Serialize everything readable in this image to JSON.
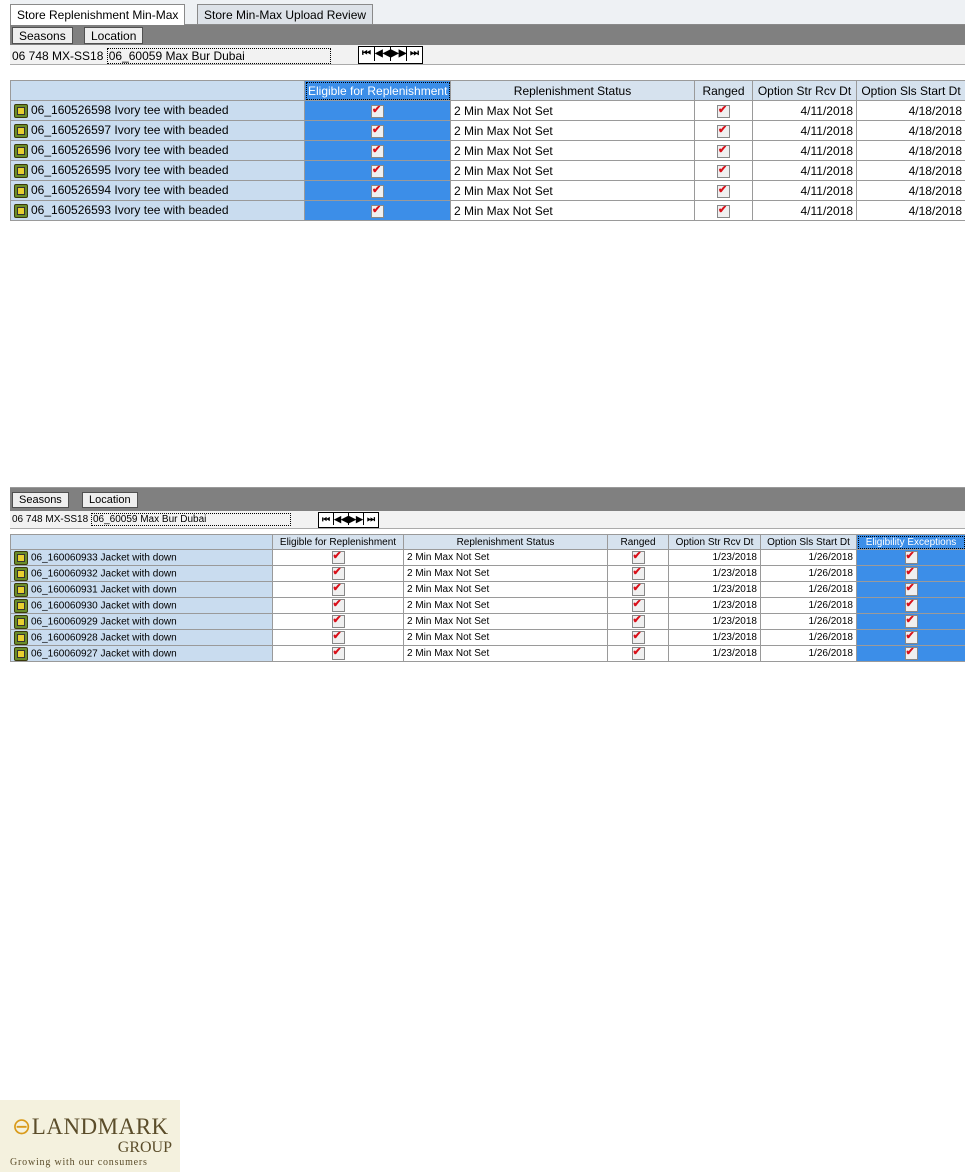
{
  "panel1": {
    "tabs": [
      "Store Replenishment Min-Max",
      "Store Min-Max Upload Review"
    ],
    "buttons": {
      "seasons": "Seasons",
      "location": "Location"
    },
    "location_prefix": "06  748  MX-SS18",
    "location_value": "06_60059 Max Bur Dubai",
    "nav": [
      "⏮",
      "◀◀",
      "▶▶",
      "⏭"
    ],
    "columns": [
      "Eligible for Replenishment",
      "Replenishment Status",
      "Ranged",
      "Option Str Rcv Dt",
      "Option Sls Start Dt"
    ],
    "rows": [
      {
        "label": "06_160526598 Ivory tee with beaded",
        "status": "2 Min Max Not Set",
        "rcv": "4/11/2018",
        "sls": "4/18/2018"
      },
      {
        "label": "06_160526597 Ivory tee with beaded",
        "status": "2 Min Max Not Set",
        "rcv": "4/11/2018",
        "sls": "4/18/2018"
      },
      {
        "label": "06_160526596 Ivory tee with beaded",
        "status": "2 Min Max Not Set",
        "rcv": "4/11/2018",
        "sls": "4/18/2018"
      },
      {
        "label": "06_160526595 Ivory tee with beaded",
        "status": "2 Min Max Not Set",
        "rcv": "4/11/2018",
        "sls": "4/18/2018"
      },
      {
        "label": "06_160526594 Ivory tee with beaded",
        "status": "2 Min Max Not Set",
        "rcv": "4/11/2018",
        "sls": "4/18/2018"
      },
      {
        "label": "06_160526593 Ivory tee with beaded",
        "status": "2 Min Max Not Set",
        "rcv": "4/11/2018",
        "sls": "4/18/2018"
      }
    ]
  },
  "panel2": {
    "buttons": {
      "seasons": "Seasons",
      "location": "Location"
    },
    "location_prefix": "06  748  MX-SS18",
    "location_value": "06_60059 Max Bur Dubai",
    "nav": [
      "⏮",
      "◀◀",
      "▶▶",
      "⏭"
    ],
    "columns": [
      "Eligible for Replenishment",
      "Replenishment Status",
      "Ranged",
      "Option Str Rcv Dt",
      "Option Sls Start Dt",
      "Eligibility Exceptions"
    ],
    "rows": [
      {
        "label": "06_160060933 Jacket with down",
        "status": "2 Min Max Not Set",
        "rcv": "1/23/2018",
        "sls": "1/26/2018"
      },
      {
        "label": "06_160060932 Jacket with down",
        "status": "2 Min Max Not Set",
        "rcv": "1/23/2018",
        "sls": "1/26/2018"
      },
      {
        "label": "06_160060931 Jacket with down",
        "status": "2 Min Max Not Set",
        "rcv": "1/23/2018",
        "sls": "1/26/2018"
      },
      {
        "label": "06_160060930 Jacket with down",
        "status": "2 Min Max Not Set",
        "rcv": "1/23/2018",
        "sls": "1/26/2018"
      },
      {
        "label": "06_160060929 Jacket with down",
        "status": "2 Min Max Not Set",
        "rcv": "1/23/2018",
        "sls": "1/26/2018"
      },
      {
        "label": "06_160060928 Jacket with down",
        "status": "2 Min Max Not Set",
        "rcv": "1/23/2018",
        "sls": "1/26/2018"
      },
      {
        "label": "06_160060927 Jacket with down",
        "status": "2 Min Max Not Set",
        "rcv": "1/23/2018",
        "sls": "1/26/2018"
      }
    ]
  },
  "logo": {
    "brand": "LANDMARK",
    "group": "GROUP",
    "tagline": "Growing with our consumers"
  },
  "colors": {
    "selection": "#3c8ee8",
    "rowhead": "#c9dcef",
    "check": "#d9101a",
    "toolbar": "#808080"
  }
}
